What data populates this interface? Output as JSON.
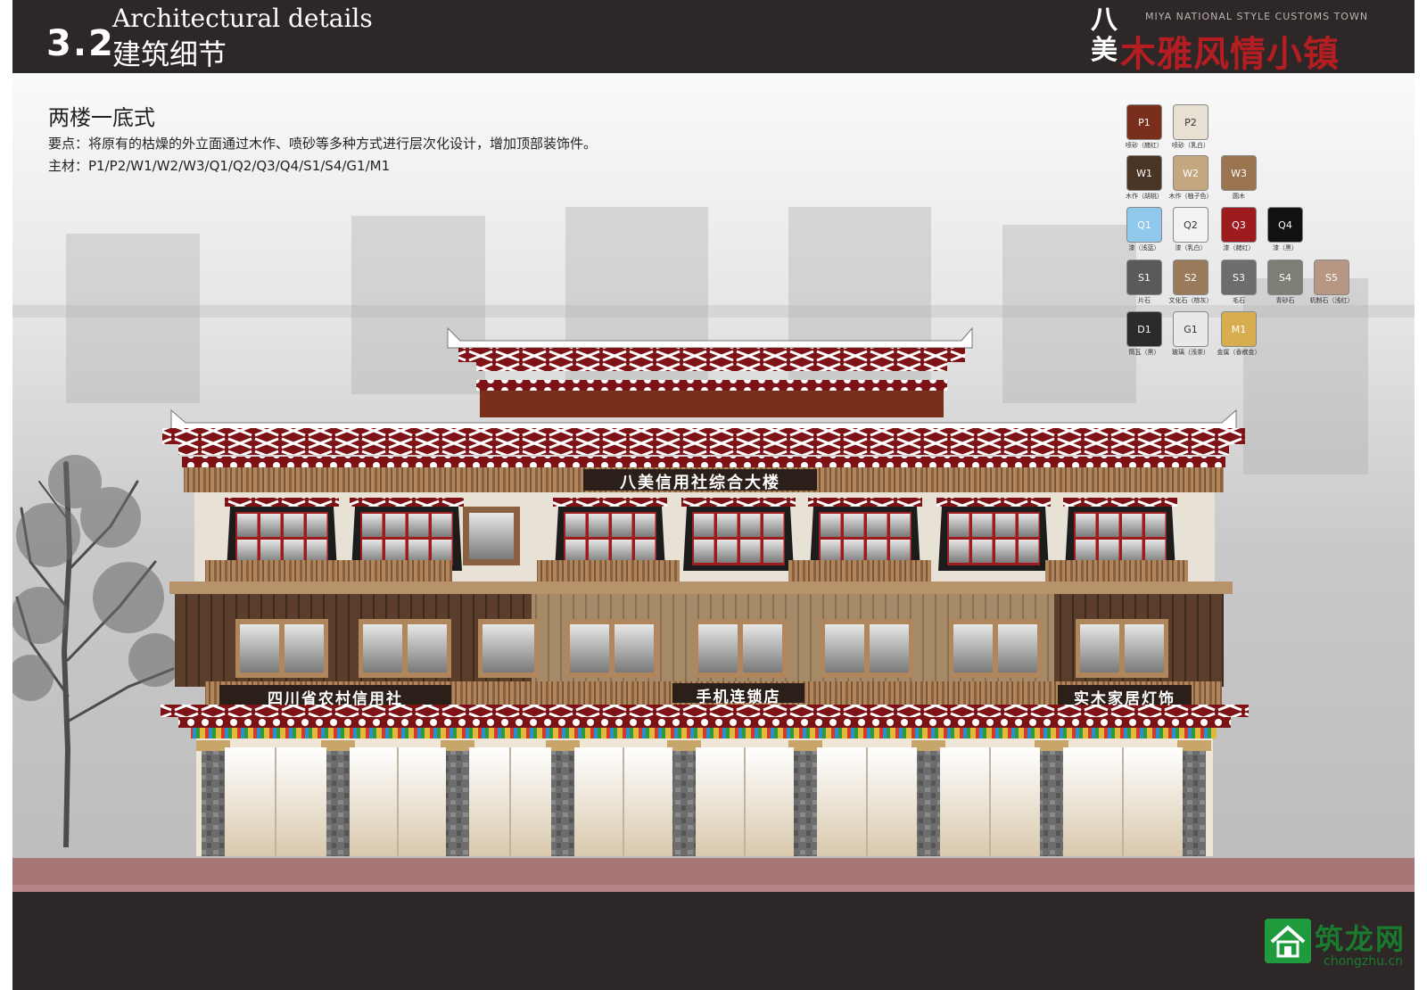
{
  "header": {
    "section_number": "3.2",
    "section_title_en": "Architectural details",
    "section_title_zh": "建筑细节",
    "brand_en": "MIYA NATIONAL STYLE CUSTOMS TOWN",
    "brand_ba": "八美",
    "brand_zh": "木雅风情小镇"
  },
  "intro": {
    "title": "两楼一底式",
    "key_points": "要点：将原有的枯燥的外立面通过木作、喷砂等多种方式进行层次化设计，增加顶部装饰件。",
    "materials": "主材：P1/P2/W1/W2/W3/Q1/Q2/Q3/Q4/S1/S4/G1/M1"
  },
  "materials": [
    {
      "code": "P1",
      "caption": "喷砂（赭红）",
      "color": "#7a2f1d"
    },
    {
      "code": "P2",
      "caption": "喷砂（乳白）",
      "color": "#e8e1d3"
    },
    {
      "code": "W1",
      "caption": "木作（胡桃）",
      "color": "#4a3424"
    },
    {
      "code": "W2",
      "caption": "木作（柚子色）",
      "color": "#c4a680"
    },
    {
      "code": "W3",
      "caption": "圆木",
      "color": "#9b7450"
    },
    {
      "code": "Q1",
      "caption": "漆（浅蓝）",
      "color": "#8fc8ea"
    },
    {
      "code": "Q2",
      "caption": "漆（乳白）",
      "color": "#f3f3f3"
    },
    {
      "code": "Q3",
      "caption": "漆（赭红）",
      "color": "#9e1b1e"
    },
    {
      "code": "Q4",
      "caption": "漆（黑）",
      "color": "#111111"
    },
    {
      "code": "S1",
      "caption": "片石",
      "color": "#5a5a5a"
    },
    {
      "code": "S2",
      "caption": "文化石（棕灰）",
      "color": "#9a7a5a"
    },
    {
      "code": "S3",
      "caption": "毛石",
      "color": "#6d6d6d"
    },
    {
      "code": "S4",
      "caption": "青砂石",
      "color": "#7d7f76"
    },
    {
      "code": "S5",
      "caption": "机制石（浅红）",
      "color": "#b89684"
    },
    {
      "code": "D1",
      "caption": "筒瓦（黑）",
      "color": "#2b2b2b"
    },
    {
      "code": "G1",
      "caption": "玻璃（浅茶）",
      "color": "#e9e9e9"
    },
    {
      "code": "M1",
      "caption": "金属（香槟金）",
      "color": "#d8ad4f"
    }
  ],
  "building": {
    "top_sign": "八美信用社综合大楼",
    "shop_left": "四川省农村信用社",
    "shop_middle": "手机连锁店",
    "shop_right": "实木家居灯饰"
  },
  "watermark": {
    "site_zh": "筑龙网",
    "site_en": "chongzhu.cn"
  }
}
